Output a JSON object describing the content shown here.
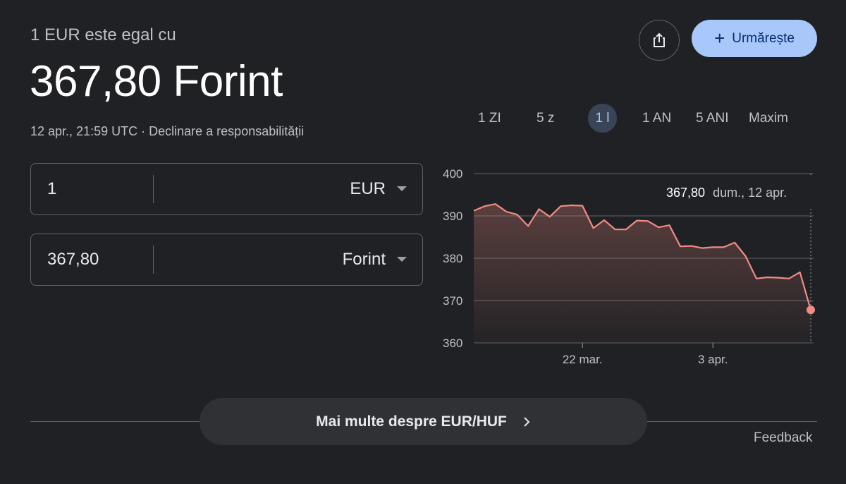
{
  "header": {
    "subtitle": "1 EUR este egal cu",
    "value": "367,80 Forint",
    "timestamp": "12 apr., 21:59 UTC",
    "separator": "·",
    "disclaimer": "Declinare a responsabilității"
  },
  "actions": {
    "share_icon": "share-icon",
    "follow_label": "Urmărește",
    "follow_icon": "+"
  },
  "converter": {
    "from": {
      "amount": "1",
      "currency": "EUR"
    },
    "to": {
      "amount": "367,80",
      "currency": "Forint"
    }
  },
  "ranges": {
    "items": [
      "1 ZI",
      "5 z",
      "1 l",
      "1 AN",
      "5 ANI",
      "Maxim"
    ],
    "selected": "1 l"
  },
  "tooltip": {
    "value": "367,80",
    "date": "dum., 12 apr."
  },
  "chart_data": {
    "type": "area",
    "title": "",
    "xlabel": "",
    "ylabel": "",
    "ylim": [
      360,
      400
    ],
    "yticks": [
      400,
      390,
      380,
      370,
      360
    ],
    "x_tick_labels": [
      "22 mar.",
      "3 apr."
    ],
    "line_color": "#f28b82",
    "grid": "horizontal",
    "series": [
      {
        "values": [
          391.2,
          392.3,
          392.8,
          391.0,
          390.3,
          387.6,
          391.6,
          389.8,
          392.3,
          392.5,
          392.4,
          387.1,
          389.0,
          386.8,
          386.8,
          388.9,
          388.8,
          387.3,
          387.8,
          382.8,
          382.9,
          382.4,
          382.6,
          382.6,
          383.7,
          380.5,
          375.2,
          375.5,
          375.4,
          375.2,
          376.7,
          367.8
        ]
      }
    ]
  },
  "footer": {
    "more_label": "Mai multe despre EUR/HUF",
    "feedback": "Feedback"
  }
}
